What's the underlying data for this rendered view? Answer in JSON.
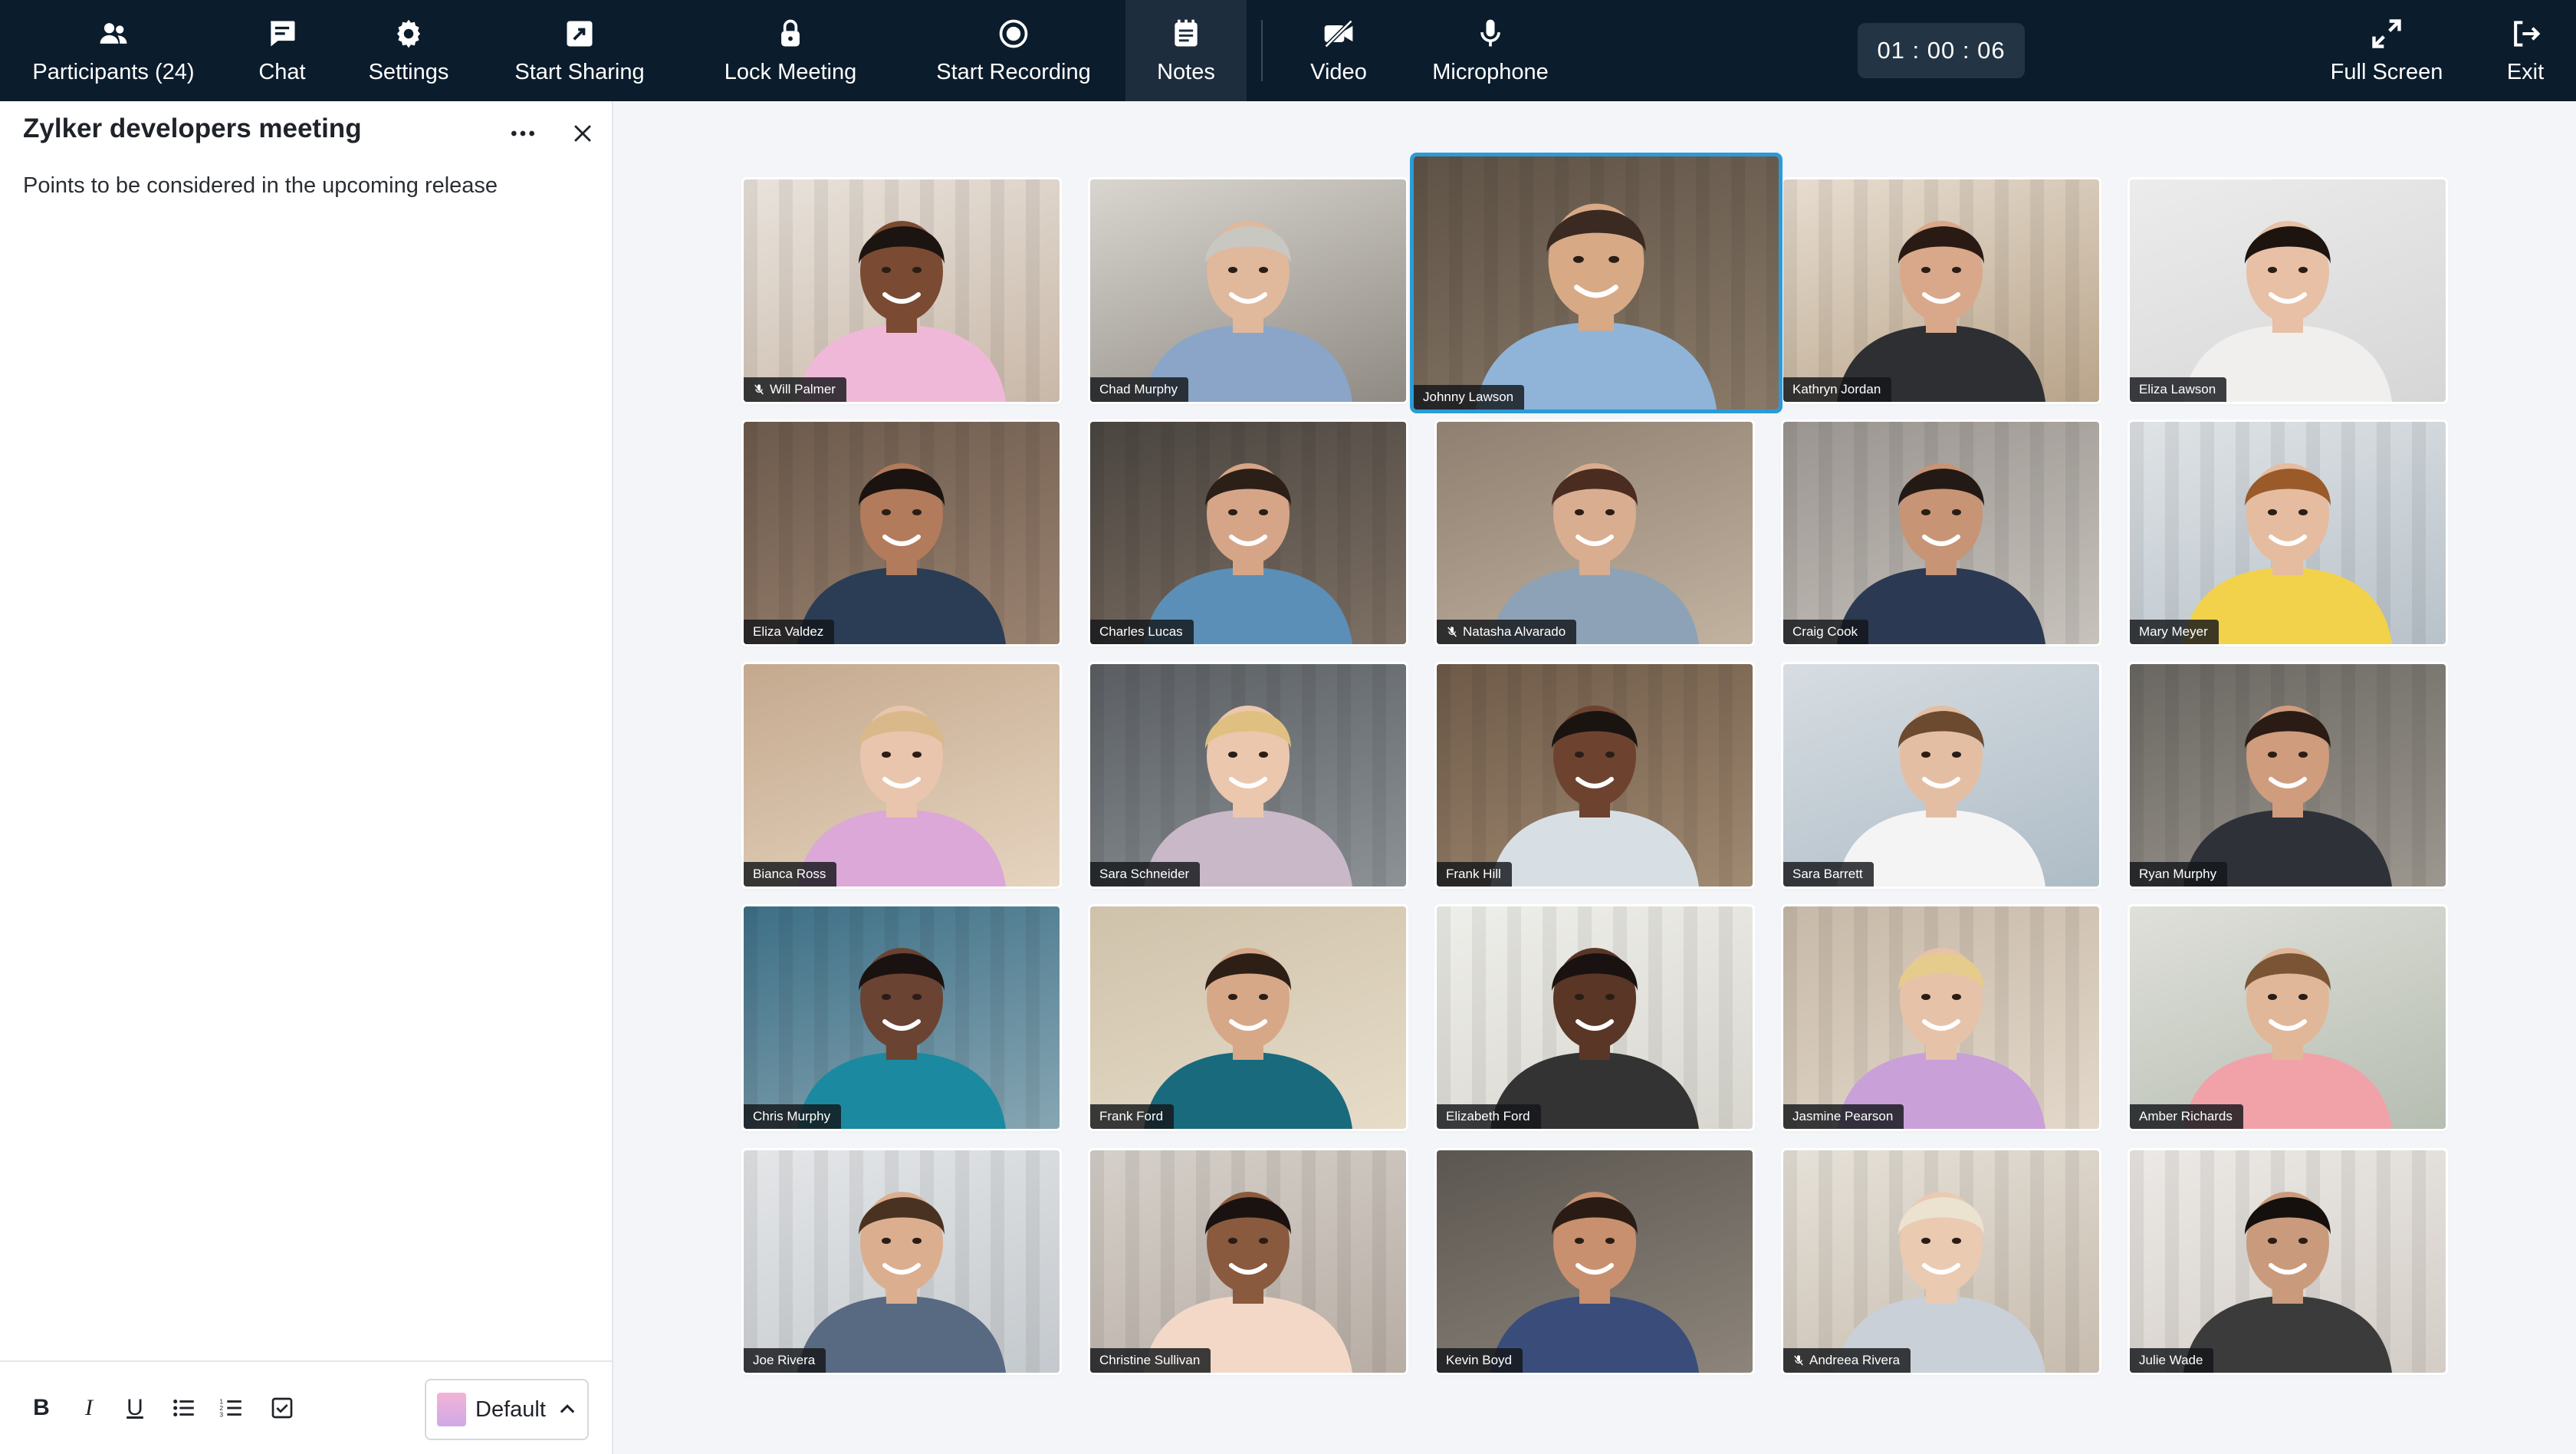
{
  "toolbar": {
    "participants_label": "Participants (24)",
    "chat_label": "Chat",
    "settings_label": "Settings",
    "sharing_label": "Start Sharing",
    "lock_label": "Lock Meeting",
    "recording_label": "Start Recording",
    "notes_label": "Notes",
    "video_label": "Video",
    "microphone_label": "Microphone",
    "timer": "01 : 00 : 06",
    "fullscreen_label": "Full Screen",
    "exit_label": "Exit"
  },
  "notes": {
    "title": "Zylker developers meeting",
    "body": "Points to be considered in the upcoming release",
    "format": {
      "bold": "B",
      "italic": "I",
      "underline": "U",
      "style_select": "Default"
    }
  },
  "participants": [
    {
      "name": "Will Palmer",
      "muted": true
    },
    {
      "name": "Chad Murphy",
      "muted": false
    },
    {
      "name": "Johnny Lawson",
      "muted": false,
      "speaking": true
    },
    {
      "name": "Kathryn Jordan",
      "muted": false
    },
    {
      "name": "Eliza Lawson",
      "muted": false
    },
    {
      "name": "Eliza Valdez",
      "muted": false
    },
    {
      "name": "Charles Lucas",
      "muted": false
    },
    {
      "name": "Natasha Alvarado",
      "muted": true
    },
    {
      "name": "Craig Cook",
      "muted": false
    },
    {
      "name": "Mary Meyer",
      "muted": false
    },
    {
      "name": "Bianca Ross",
      "muted": false
    },
    {
      "name": "Sara Schneider",
      "muted": false
    },
    {
      "name": "Frank Hill",
      "muted": false
    },
    {
      "name": "Sara Barrett",
      "muted": false
    },
    {
      "name": "Ryan Murphy",
      "muted": false
    },
    {
      "name": "Chris Murphy",
      "muted": false
    },
    {
      "name": "Frank Ford",
      "muted": false
    },
    {
      "name": "Elizabeth Ford",
      "muted": false
    },
    {
      "name": "Jasmine Pearson",
      "muted": false
    },
    {
      "name": "Amber Richards",
      "muted": false
    },
    {
      "name": "Joe Rivera",
      "muted": false
    },
    {
      "name": "Christine Sullivan",
      "muted": false
    },
    {
      "name": "Kevin Boyd",
      "muted": false
    },
    {
      "name": "Andreea Rivera",
      "muted": true
    },
    {
      "name": "Julie Wade",
      "muted": false
    }
  ],
  "colors": {
    "toolbar_bg": "#0b1c2c",
    "active_speaker_border": "#2a9bd8"
  }
}
